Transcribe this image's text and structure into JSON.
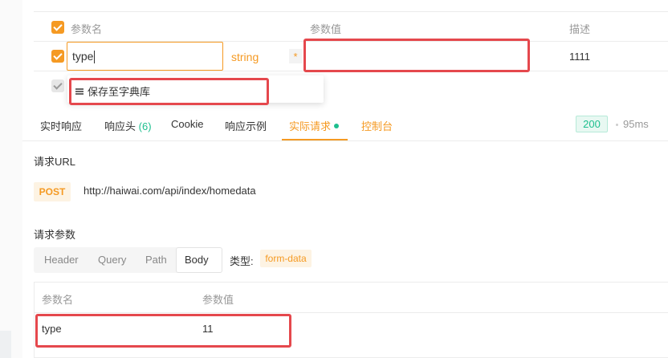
{
  "params_table": {
    "headers": {
      "name": "参数名",
      "value": "参数值",
      "desc": "描述"
    },
    "row": {
      "name": "type",
      "type": "string",
      "required_mark": "*",
      "value": "",
      "desc": "1111"
    }
  },
  "suggestion": {
    "label": "保存至字典库",
    "icon": "menu-icon"
  },
  "tabs": [
    {
      "label": "实时响应"
    },
    {
      "label": "响应头",
      "count": "(6)"
    },
    {
      "label": "Cookie"
    },
    {
      "label": "响应示例"
    },
    {
      "label": "实际请求"
    },
    {
      "label": "控制台"
    }
  ],
  "status": {
    "code": "200",
    "time": "95ms"
  },
  "request": {
    "url_title": "请求URL",
    "method": "POST",
    "url": "http://haiwai.com/api/index/homedata",
    "params_title": "请求参数",
    "segments": [
      "Header",
      "Query",
      "Path",
      "Body"
    ],
    "kind_label": "类型:",
    "kind_value": "form-data",
    "body_table": {
      "headers": {
        "name": "参数名",
        "value": "参数值"
      },
      "row": {
        "name": "type",
        "value": "11"
      }
    }
  },
  "colors": {
    "accent": "#f59a23",
    "success": "#1dbf8e",
    "highlight": "#e5484d"
  }
}
